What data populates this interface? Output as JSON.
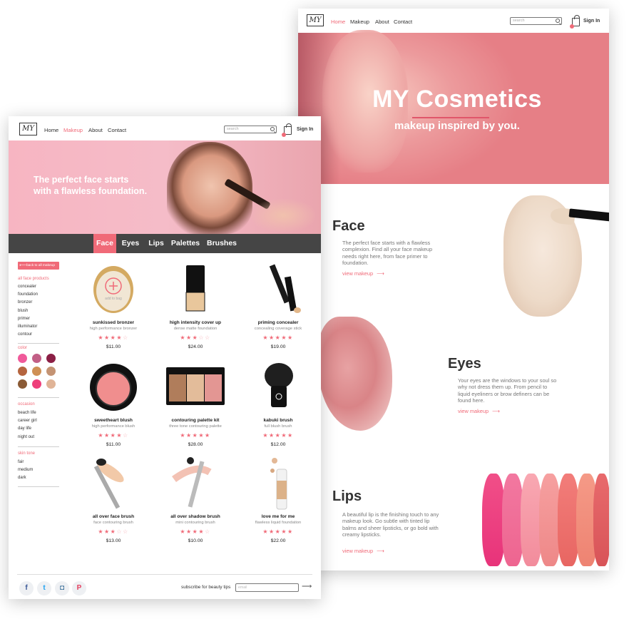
{
  "home": {
    "logo": "MY",
    "nav": {
      "links": [
        "Home",
        "Makeup",
        "About",
        "Contact"
      ],
      "active": 0
    },
    "search_placeholder": "search",
    "signin": "Sign In",
    "hero": {
      "title": "MY Cosmetics",
      "subtitle": "makeup inspired by you."
    },
    "sections": [
      {
        "title": "Face",
        "text": "The perfect face starts with a flawless complexion. Find all your face makeup needs right here, from face primer to foundation.",
        "link": "view makeup"
      },
      {
        "title": "Eyes",
        "text": "Your eyes are the windows to your soul so why not dress them up. From pencil to liquid eyeliners or brow definers can be found here.",
        "link": "view makeup"
      },
      {
        "title": "Lips",
        "text": "A beautiful lip is the finishing touch to any makeup look. Go subtle with tinted lip balms and sheer lipsticks, or go bold with creamy lipsticks.",
        "link": "view makeup"
      }
    ],
    "arrow": "⟶"
  },
  "makeup": {
    "logo": "MY",
    "nav": {
      "links": [
        "Home",
        "Makeup",
        "About",
        "Contact"
      ],
      "active": 1
    },
    "search_placeholder": "search",
    "signin": "Sign In",
    "banner_line1": "The perfect face starts",
    "banner_line2": "with a flawless foundation.",
    "categories": [
      "Face",
      "Eyes",
      "Lips",
      "Palettes",
      "Brushes"
    ],
    "active_category": 0,
    "back_button": "back to all makeup",
    "sidebar": {
      "face_head": "all face products",
      "face_items": [
        "concealer",
        "foundation",
        "bronzer",
        "blush",
        "primer",
        "illuminator",
        "contour"
      ],
      "color_head": "color",
      "colors": [
        "#f05a9a",
        "#c25f86",
        "#8b1f45",
        "#b5653f",
        "#cf9055",
        "#c49373",
        "#8a5a35",
        "#ee3f7a",
        "#e0b497"
      ],
      "occasion_head": "occasion",
      "occasion_items": [
        "beach life",
        "career girl",
        "day life",
        "night out"
      ],
      "skin_head": "skin tone",
      "skin_items": [
        "fair",
        "medium",
        "dark"
      ]
    },
    "add_to_bag": "add to bag",
    "products": [
      {
        "name": "sunkissed bronzer",
        "sub": "high performance bronzer",
        "rating": 4,
        "price": "$11.00",
        "icon": "bronzer-compact-icon"
      },
      {
        "name": "high intensity cover up",
        "sub": "dense matte foundation",
        "rating": 3,
        "price": "$24.00",
        "icon": "foundation-bottle-icon"
      },
      {
        "name": "priming concealer",
        "sub": "concealing coverage stick",
        "rating": 5,
        "price": "$19.00",
        "icon": "concealer-wand-icon"
      },
      {
        "name": "sweetheart blush",
        "sub": "high performance blush",
        "rating": 4,
        "price": "$11.00",
        "icon": "blush-compact-icon"
      },
      {
        "name": "contouring palette kit",
        "sub": "three tone contouring palette",
        "rating": 5,
        "price": "$28.00",
        "icon": "contour-palette-icon"
      },
      {
        "name": "kabuki brush",
        "sub": "full blush brush",
        "rating": 5,
        "price": "$12.00",
        "icon": "kabuki-brush-icon"
      },
      {
        "name": "all over face brush",
        "sub": "face contouring brush",
        "rating": 3,
        "price": "$13.00",
        "icon": "face-brush-icon"
      },
      {
        "name": "all over shadow brush",
        "sub": "mini contouring brush",
        "rating": 4,
        "price": "$10.00",
        "icon": "shadow-brush-icon"
      },
      {
        "name": "love me for me",
        "sub": "flawless liquid foundation",
        "rating": 5,
        "price": "$22.00",
        "icon": "liquid-foundation-icon"
      }
    ],
    "footer": {
      "social": [
        {
          "glyph": "f",
          "icon": "facebook-icon",
          "color": "#3b5998"
        },
        {
          "glyph": "t",
          "icon": "twitter-icon",
          "color": "#1da1f2"
        },
        {
          "glyph": "◘",
          "icon": "instagram-icon",
          "color": "#3f729b"
        },
        {
          "glyph": "P",
          "icon": "pinterest-icon",
          "color": "#e4405f"
        }
      ],
      "subscribe_label": "subscribe for beauty tips",
      "email_placeholder": "email",
      "submit_arrow": "⟶"
    }
  },
  "colors": {
    "accent": "#f06a78",
    "dark_bar": "#454545"
  }
}
